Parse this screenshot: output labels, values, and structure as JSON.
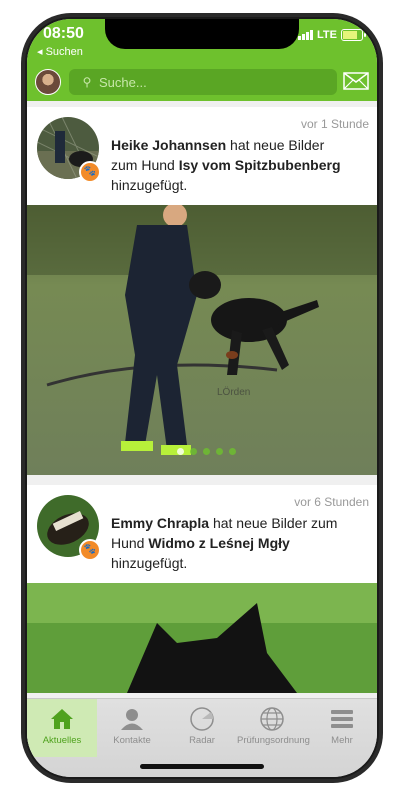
{
  "status_bar": {
    "time": "08:50",
    "back_label": "◂ Suchen",
    "carrier": "LTE"
  },
  "header": {
    "search_placeholder": "Suche..."
  },
  "feed": [
    {
      "time_ago": "vor 1 Stunde",
      "user": "Heike Johannsen",
      "action": "hat neue Bilder zum Hund",
      "dog": "Isy vom Spitzbubenberg",
      "suffix": "hinzugefügt.",
      "photo_dots": 5
    },
    {
      "time_ago": "vor 6 Stunden",
      "user": "Emmy Chrapla",
      "action": "hat neue Bilder zum Hund",
      "dog": "Widmo z Leśnej Mgły",
      "suffix": "hinzugefügt."
    }
  ],
  "tabbar": {
    "items": [
      {
        "label": "Aktuelles",
        "icon": "home-icon",
        "active": true
      },
      {
        "label": "Kontakte",
        "icon": "person-icon"
      },
      {
        "label": "Radar",
        "icon": "radar-icon"
      },
      {
        "label": "Prüfungsordnung",
        "icon": "globe-icon"
      },
      {
        "label": "Mehr",
        "icon": "menu-icon"
      }
    ]
  },
  "colors": {
    "accent": "#6ec12d",
    "badge": "#f28b29"
  }
}
